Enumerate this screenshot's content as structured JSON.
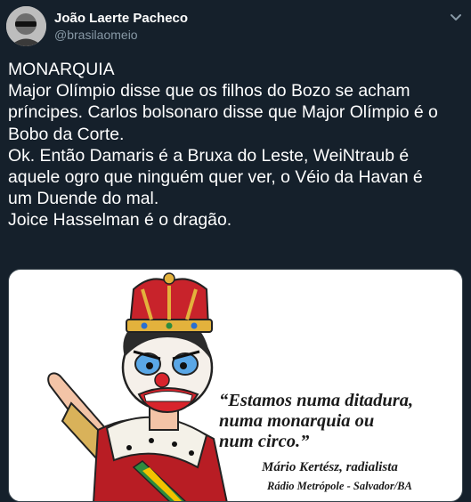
{
  "author": {
    "name": "João Laerte Pacheco",
    "handle": "@brasilaomeio"
  },
  "tweet": {
    "lines": [
      "MONARQUIA",
      "Major Olímpio disse que os filhos do Bozo se acham",
      "príncipes. Carlos bolsonaro disse que Major Olímpio é o",
      "Bobo da Corte.",
      "Ok. Então Damaris é a Bruxa do Leste, WeiNtraub é",
      "aquele ogro que ninguém quer ver, o Véio da Havan é",
      "um Duende do mal.",
      "Joice Hasselman é o dragão."
    ]
  },
  "media": {
    "quote_lines": [
      "“Estamos numa ditadura,",
      "numa monarquia ou",
      "num circo.”"
    ],
    "attribution": "Mário Kertész, radialista",
    "source": "Rádio Metrópole - Salvador/BA"
  },
  "icons": {
    "more": "chevron-down-icon"
  },
  "colors": {
    "background": "#15202b",
    "text": "#ffffff",
    "secondary_text": "#8899a6"
  }
}
